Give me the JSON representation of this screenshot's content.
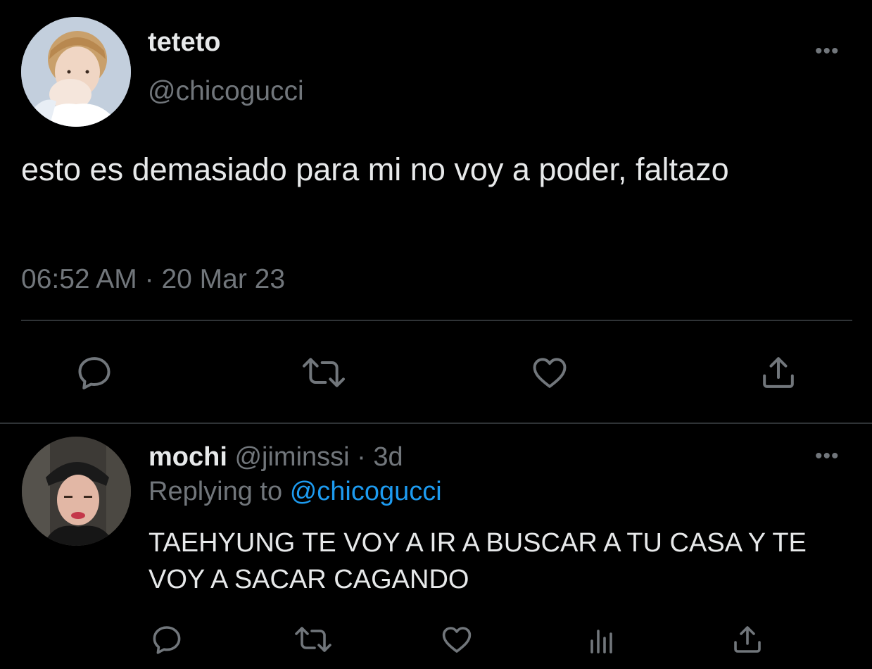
{
  "main_tweet": {
    "author": {
      "display_name": "teteto",
      "handle": "@chicogucci"
    },
    "text": "esto es demasiado para mi no voy a poder, faltazo",
    "time": "06:52 AM",
    "separator": "·",
    "date": "20 Mar 23",
    "more_label": "•••",
    "actions": [
      {
        "name": "reply",
        "icon": "comment-icon"
      },
      {
        "name": "retweet",
        "icon": "retweet-icon"
      },
      {
        "name": "like",
        "icon": "heart-icon"
      },
      {
        "name": "share",
        "icon": "share-icon"
      }
    ]
  },
  "reply": {
    "author": {
      "display_name": "mochi",
      "handle": "@jiminssi",
      "separator": "·",
      "age": "3d"
    },
    "replying_prefix": "Replying to",
    "replying_to": "@chicogucci",
    "text": "TAEHYUNG TE VOY A IR A BUSCAR A TU CASA Y TE VOY A SACAR CAGANDO",
    "more_label": "•••",
    "actions": [
      {
        "name": "reply",
        "icon": "comment-icon"
      },
      {
        "name": "retweet",
        "icon": "retweet-icon"
      },
      {
        "name": "like",
        "icon": "heart-icon"
      },
      {
        "name": "analytics",
        "icon": "analytics-icon"
      },
      {
        "name": "share",
        "icon": "share-icon"
      }
    ]
  },
  "colors": {
    "background": "#000000",
    "text_primary": "#e7e9ea",
    "text_muted": "#71767b",
    "link": "#1d9bf0",
    "divider": "#2f3336"
  }
}
